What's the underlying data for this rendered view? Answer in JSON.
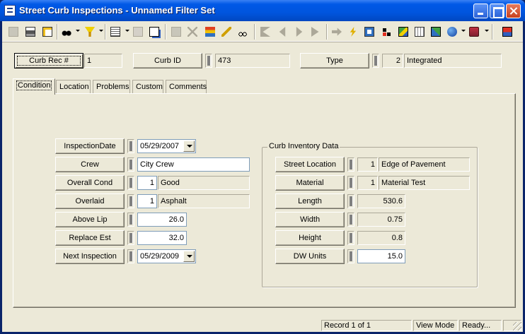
{
  "window": {
    "title": "Street Curb Inspections - Unnamed Filter Set"
  },
  "header": {
    "curb_rec_label": "Curb Rec #",
    "curb_rec_value": "1",
    "curb_id_label": "Curb ID",
    "curb_id_value": "473",
    "type_label": "Type",
    "type_code": "2",
    "type_value": "Integrated"
  },
  "tabs": [
    "Condition",
    "Location",
    "Problems",
    "Custom",
    "Comments"
  ],
  "condition": {
    "inspection_date_label": "InspectionDate",
    "inspection_date_value": "05/29/2007",
    "crew_label": "Crew",
    "crew_value": "City Crew",
    "overall_cond_label": "Overall Cond",
    "overall_cond_code": "1",
    "overall_cond_value": "Good",
    "overlaid_label": "Overlaid",
    "overlaid_code": "1",
    "overlaid_value": "Asphalt",
    "above_lip_label": "Above Lip",
    "above_lip_value": "26.0",
    "replace_est_label": "Replace Est",
    "replace_est_value": "32.0",
    "next_inspection_label": "Next Inspection",
    "next_inspection_value": "05/29/2009"
  },
  "inventory": {
    "title": "Curb Inventory Data",
    "street_location_label": "Street Location",
    "street_location_code": "1",
    "street_location_value": "Edge of Pavement",
    "material_label": "Material",
    "material_code": "1",
    "material_value": "Material Test",
    "length_label": "Length",
    "length_value": "530.6",
    "width_label": "Width",
    "width_value": "0.75",
    "height_label": "Height",
    "height_value": "0.8",
    "dw_units_label": "DW Units",
    "dw_units_value": "15.0"
  },
  "status": {
    "record": "Record 1 of 1",
    "mode": "View Mode",
    "state": "Ready..."
  }
}
